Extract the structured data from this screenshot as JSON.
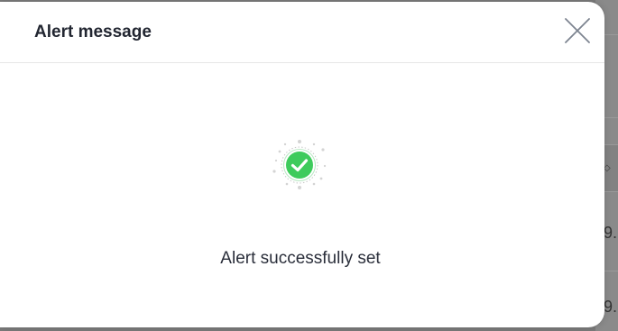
{
  "dialog": {
    "title": "Alert message",
    "message": "Alert successfully set",
    "close_icon": "close-icon",
    "status_icon": "success-check-icon"
  },
  "background": {
    "sort_icon": "sort-icon",
    "cells": [
      "9.",
      "9."
    ]
  },
  "colors": {
    "success": "#3ecb5c",
    "title": "#222631",
    "text": "#2a2e3a",
    "divider": "#e6e6e6",
    "close": "#7d8490"
  }
}
